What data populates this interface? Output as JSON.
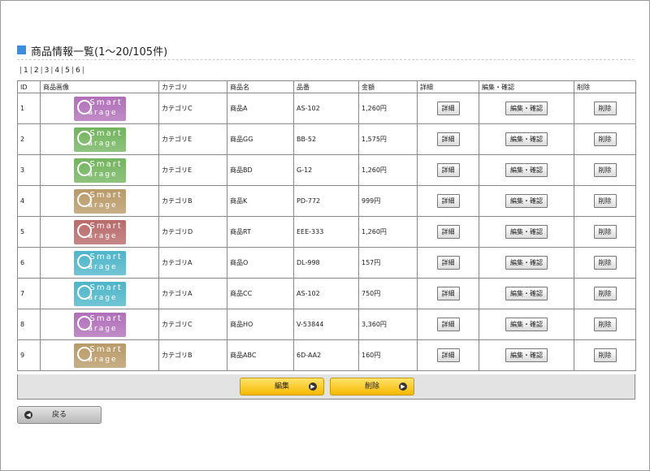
{
  "title": "商品情報一覧(1〜20/105件)",
  "pager": [
    "1",
    "2",
    "3",
    "4",
    "5",
    "6"
  ],
  "table": {
    "headers": [
      "ID",
      "商品画像",
      "カテゴリ",
      "商品名",
      "品番",
      "金額",
      "詳細",
      "編集・確認",
      "削除"
    ],
    "rows": [
      {
        "id": "1",
        "category": "カテゴリC",
        "name": "商品A",
        "code": "AS-102",
        "price": "1,260円",
        "color": "#b06fb8"
      },
      {
        "id": "2",
        "category": "カテゴリE",
        "name": "商品GG",
        "code": "BB-52",
        "price": "1,575円",
        "color": "#72b45e"
      },
      {
        "id": "3",
        "category": "カテゴリE",
        "name": "商品BD",
        "code": "G-12",
        "price": "1,260円",
        "color": "#72b45e"
      },
      {
        "id": "4",
        "category": "カテゴリB",
        "name": "商品K",
        "code": "PD-772",
        "price": "999円",
        "color": "#b99a68"
      },
      {
        "id": "5",
        "category": "カテゴリD",
        "name": "商品RT",
        "code": "EEE-333",
        "price": "1,260円",
        "color": "#b86a6a"
      },
      {
        "id": "6",
        "category": "カテゴリA",
        "name": "商品O",
        "code": "DL-998",
        "price": "157円",
        "color": "#4eb5c9"
      },
      {
        "id": "7",
        "category": "カテゴリA",
        "name": "商品CC",
        "code": "AS-102",
        "price": "750円",
        "color": "#4eb5c9"
      },
      {
        "id": "8",
        "category": "カテゴリC",
        "name": "商品HO",
        "code": "V-53844",
        "price": "3,360円",
        "color": "#b06fb8"
      },
      {
        "id": "9",
        "category": "カテゴリB",
        "name": "商品ABC",
        "code": "6D-AA2",
        "price": "160円",
        "color": "#b99a68"
      }
    ]
  },
  "logo": {
    "line1": "Smart",
    "line2": "arage"
  },
  "row_buttons": {
    "detail": "詳細",
    "edit": "編集・確認",
    "delete": "削除"
  },
  "footer": {
    "edit": "編集",
    "delete": "削除"
  },
  "back": "戻る",
  "icons": {
    "title": "square-icon",
    "arrow": "arrow-right-icon",
    "back": "arrow-left-icon"
  }
}
